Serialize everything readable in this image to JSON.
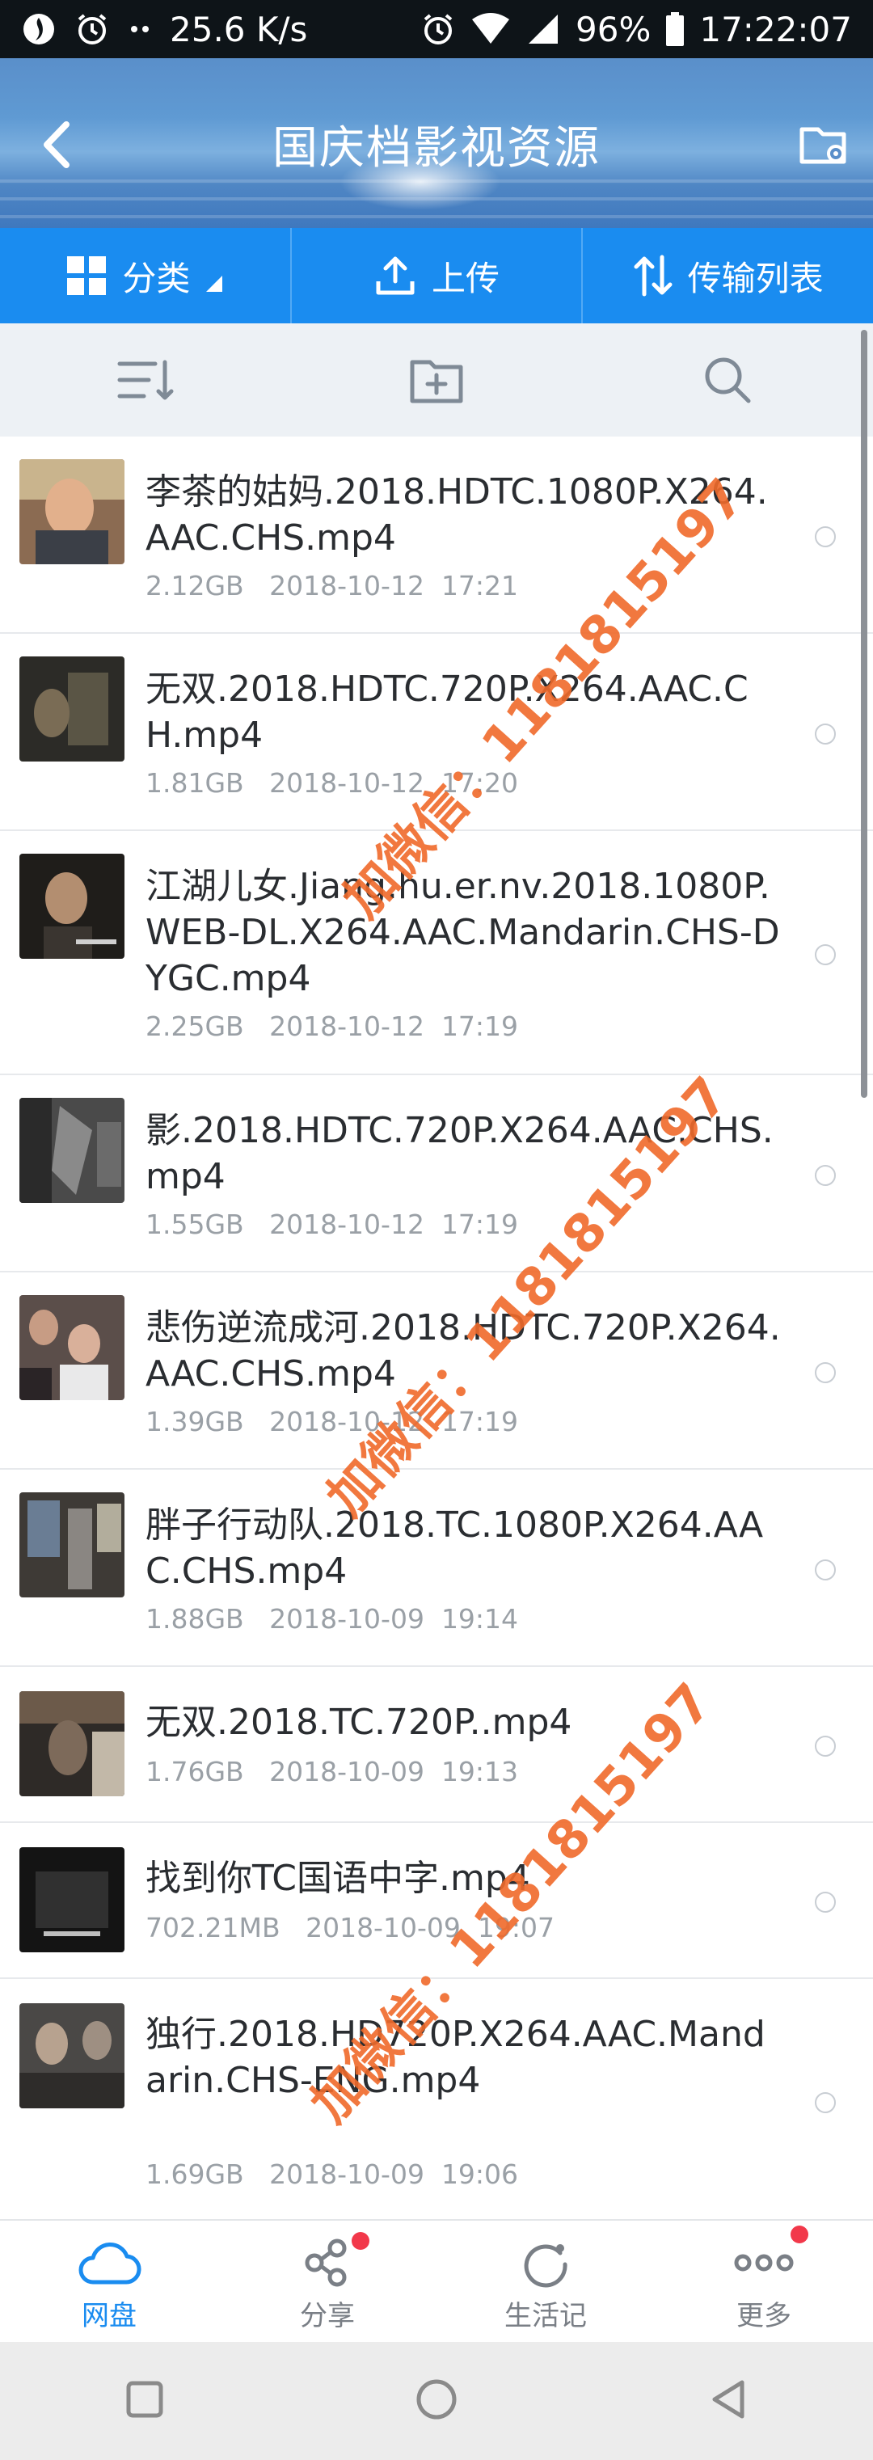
{
  "status_bar": {
    "speed": "25.6 K/s",
    "battery": "96%",
    "time": "17:22:07"
  },
  "header": {
    "title": "国庆档影视资源"
  },
  "toolbar": {
    "category": "分类",
    "upload": "上传",
    "transfer": "传输列表"
  },
  "files": [
    {
      "name": "李茶的姑妈.2018.HDTC.1080P.X264.AAC.CHS.mp4",
      "size": "2.12GB",
      "date": "2018-10-12",
      "time": "17:21"
    },
    {
      "name": "无双.2018.HDTC.720P.X264.AAC.CH.mp4",
      "size": "1.81GB",
      "date": "2018-10-12",
      "time": "17:20"
    },
    {
      "name": "江湖儿女.Jiang.hu.er.nv.2018.1080P.WEB-DL.X264.AAC.Mandarin.CHS-DYGC.mp4",
      "size": "2.25GB",
      "date": "2018-10-12",
      "time": "17:19"
    },
    {
      "name": "影.2018.HDTC.720P.X264.AAC.CHS.mp4",
      "size": "1.55GB",
      "date": "2018-10-12",
      "time": "17:19"
    },
    {
      "name": "悲伤逆流成河.2018.HDTC.720P.X264.AAC.CHS.mp4",
      "size": "1.39GB",
      "date": "2018-10-12",
      "time": "17:19"
    },
    {
      "name": "胖子行动队.2018.TC.1080P.X264.AAC.CHS.mp4",
      "size": "1.88GB",
      "date": "2018-10-09",
      "time": "19:14"
    },
    {
      "name": "无双.2018.TC.720P..mp4",
      "size": "1.76GB",
      "date": "2018-10-09",
      "time": "19:13"
    },
    {
      "name": "找到你TC国语中字.mp4",
      "size": "702.21MB",
      "date": "2018-10-09",
      "time": "19:07"
    },
    {
      "name": "独行.2018.HD720P.X264.AAC.Mandarin.CHS-ENG.mp4",
      "size": "1.69GB",
      "date": "2018-10-09",
      "time": "19:06"
    }
  ],
  "watermarks": [
    {
      "text": "加微信：1181815197"
    },
    {
      "text": "加微信：1181815197"
    },
    {
      "text": "加微信：1181815197"
    }
  ],
  "tabs": [
    {
      "label": "网盘",
      "icon": "cloud-icon"
    },
    {
      "label": "分享",
      "icon": "share-icon"
    },
    {
      "label": "生活记",
      "icon": "refresh-circle-icon"
    },
    {
      "label": "更多",
      "icon": "more-dots-icon"
    }
  ],
  "colors": {
    "accent": "#1a8cf0",
    "watermark": "#f06a2b",
    "badge": "#f2384a"
  }
}
